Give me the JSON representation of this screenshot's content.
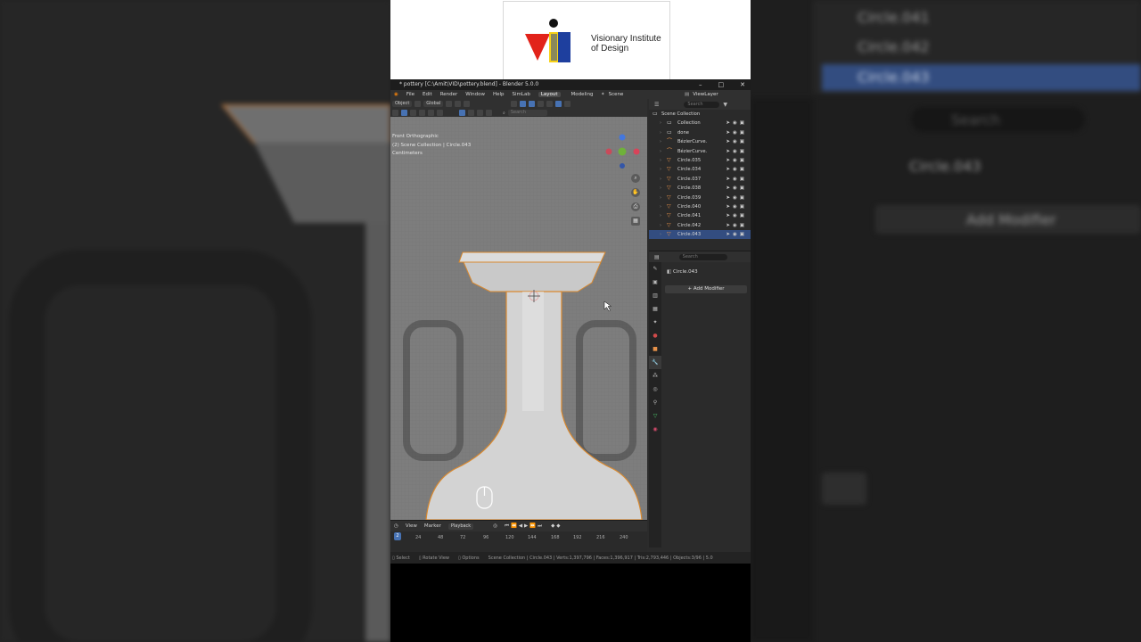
{
  "logo": {
    "text": "Visionary Institute of Design",
    "colors": {
      "red": "#e2231a",
      "blue": "#1e3f9e",
      "yellow": "#f7d117",
      "black": "#111111"
    }
  },
  "window": {
    "title": "* pottery [C:\\Amit\\VID\\pottery.blend] - Blender 5.0.0",
    "buttons": [
      "–",
      "□",
      "✕"
    ]
  },
  "menubar": {
    "items": [
      "File",
      "Edit",
      "Render",
      "Window",
      "Help",
      "SimLab"
    ],
    "workspaces": [
      "Layout",
      "Modeling"
    ],
    "scene": "Scene",
    "view_layer": "ViewLayer"
  },
  "viewport_header": {
    "mode": "Object",
    "orientation": "Global",
    "search_placeholder": "Search"
  },
  "viewport": {
    "view_name": "Front Orthographic",
    "collection_path": "(2) Scene Collection | Circle.043",
    "units": "Centimeters",
    "gizmo_axes": [
      "Z",
      "Y",
      "X"
    ]
  },
  "timeline": {
    "menus": [
      "View",
      "Marker",
      "Playback"
    ],
    "current_frame": "2",
    "ticks": [
      "24",
      "48",
      "72",
      "96",
      "120",
      "144",
      "168",
      "192",
      "216",
      "240"
    ]
  },
  "statusbar": {
    "select": "Select",
    "rotate": "Rotate View",
    "options": "Options",
    "stats": "Scene Collection | Circle.043 | Verts:1,397,796 | Faces:1,396,917 | Tris:2,793,446 | Objects:3/96 | 5.0"
  },
  "outliner": {
    "search_placeholder": "Search",
    "root": "Scene Collection",
    "items": [
      {
        "name": "Collection",
        "type": "collection"
      },
      {
        "name": "done",
        "type": "collection"
      },
      {
        "name": "BézierCurve.",
        "type": "curve"
      },
      {
        "name": "BézierCurve.",
        "type": "curve"
      },
      {
        "name": "Circle.035",
        "type": "mesh"
      },
      {
        "name": "Circle.034",
        "type": "mesh"
      },
      {
        "name": "Circle.037",
        "type": "mesh"
      },
      {
        "name": "Circle.038",
        "type": "mesh"
      },
      {
        "name": "Circle.039",
        "type": "mesh"
      },
      {
        "name": "Circle.040",
        "type": "mesh"
      },
      {
        "name": "Circle.041",
        "type": "mesh"
      },
      {
        "name": "Circle.042",
        "type": "mesh"
      },
      {
        "name": "Circle.043",
        "type": "mesh",
        "selected": true
      }
    ]
  },
  "properties": {
    "search_placeholder": "Search",
    "object_name": "Circle.043",
    "add_modifier": "Add Modifier"
  },
  "background_right": {
    "rows": [
      "Circle.041",
      "Circle.042",
      "Circle.043"
    ],
    "search_placeholder": "Search",
    "object_name": "Circle.043",
    "add_modifier": "Add Modifier"
  }
}
